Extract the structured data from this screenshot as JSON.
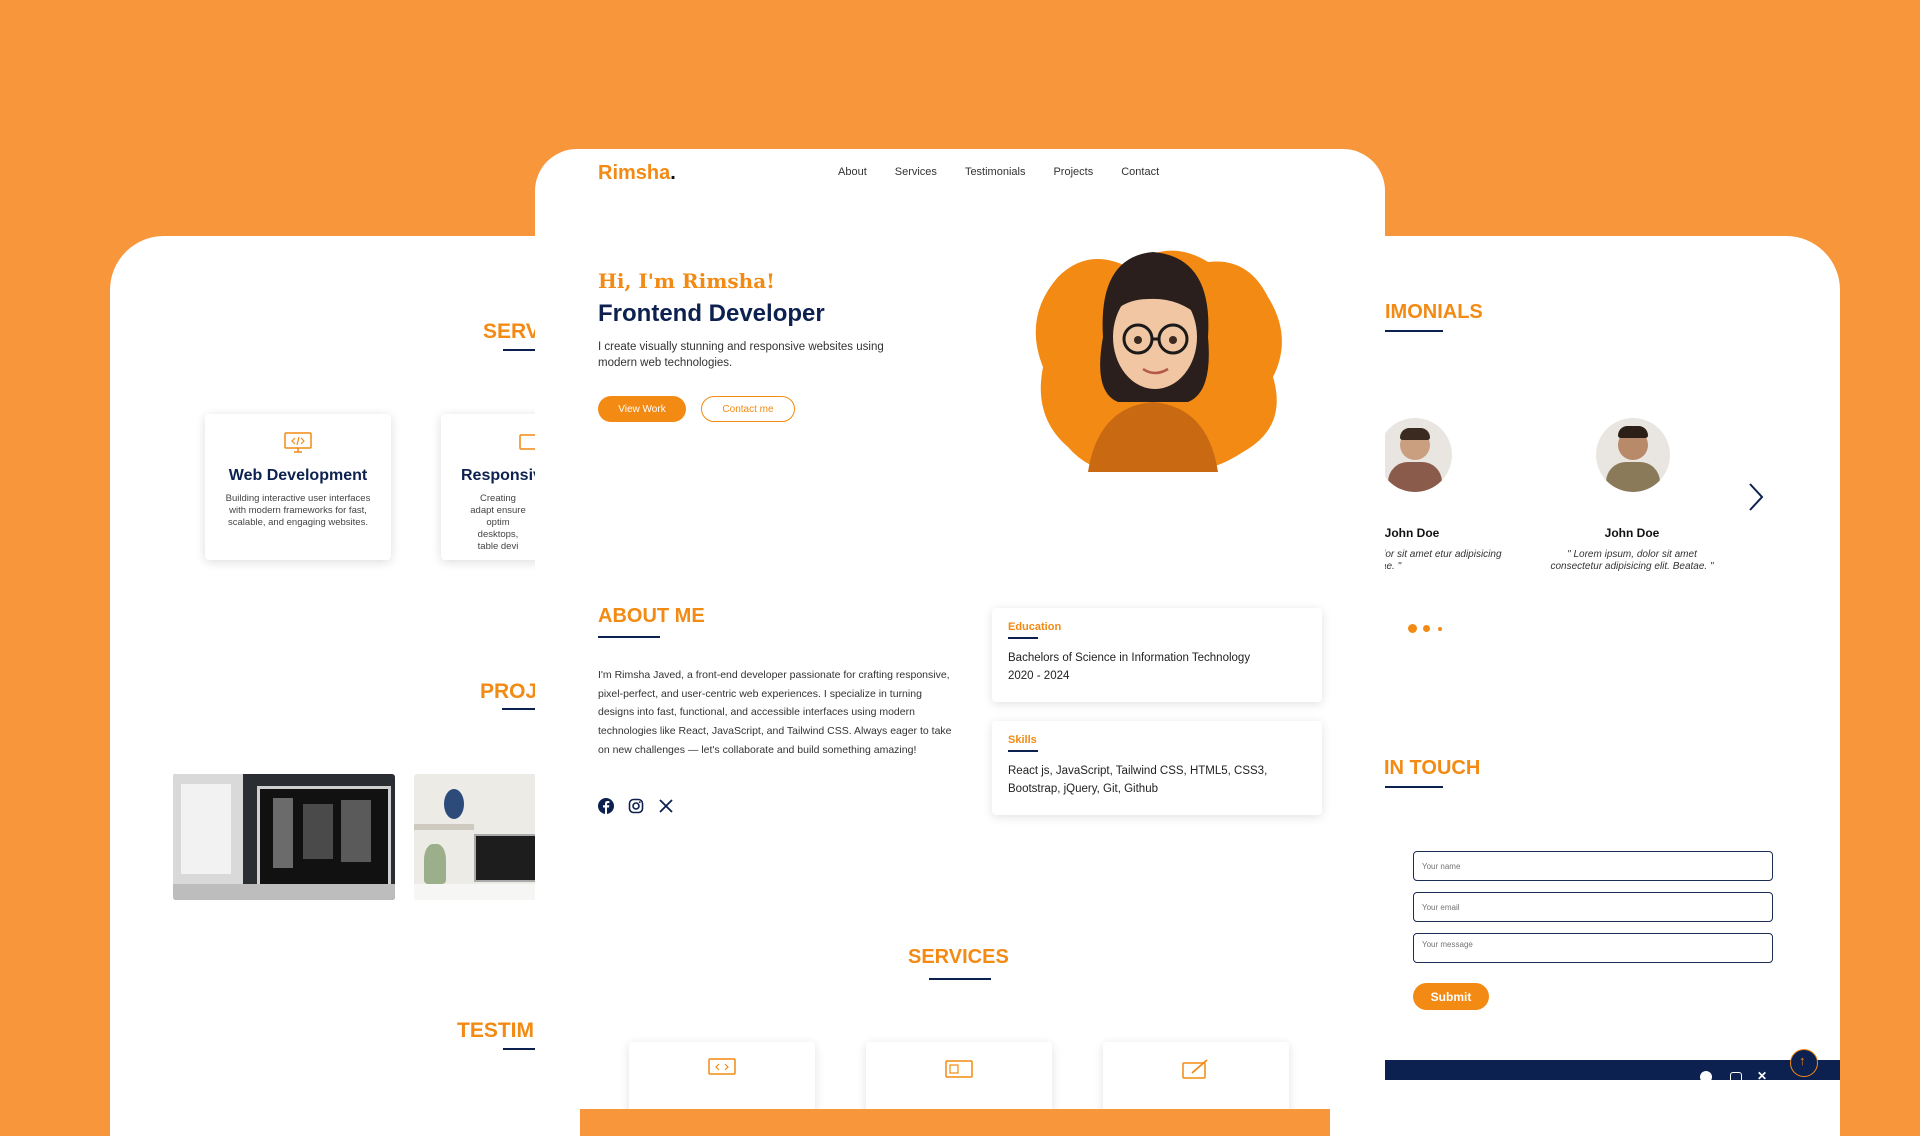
{
  "brand": {
    "name": "Rimsha",
    "dot": "."
  },
  "nav": [
    "About",
    "Services",
    "Testimonials",
    "Projects",
    "Contact"
  ],
  "hero": {
    "greeting": "Hi, I'm Rimsha!",
    "role": "Frontend Developer",
    "description": "I create visually stunning and responsive websites using modern web technologies.",
    "primary_button": "View Work",
    "secondary_button": "Contact me"
  },
  "about": {
    "heading": "ABOUT ME",
    "text": "I'm Rimsha Javed, a front-end developer passionate for crafting responsive, pixel-perfect, and user-centric web experiences. I specialize in turning designs into fast, functional, and accessible interfaces using modern technologies like React, JavaScript, and Tailwind CSS. Always eager to take on new challenges — let's collaborate and build something amazing!",
    "education_label": "Education",
    "education_text": "Bachelors of Science in Information Technology 2020 - 2024",
    "skills_label": "Skills",
    "skills_text": "React js, JavaScript, Tailwind CSS, HTML5, CSS3, Bootstrap, jQuery, Git, Github"
  },
  "services_heading": "SERVICES",
  "left_panel": {
    "services_heading_partial": "SERV",
    "projects_heading_partial": "PROJ",
    "testimonials_heading_partial": "TESTIM",
    "card1_title": "Web Development",
    "card1_desc": "Building interactive user interfaces with modern frameworks for fast, scalable, and engaging websites.",
    "card2_title": "Responsiv",
    "card2_desc": "Creating adapt ensure optim desktops, table devi"
  },
  "right_panel": {
    "testimonials_heading_partial": "IMONIALS",
    "contact_heading_partial": "IN TOUCH",
    "testimonials": [
      {
        "name": "John Doe",
        "quote": "osum, dolor sit amet etur adipisicing elit. Beatae. \""
      },
      {
        "name": "John Doe",
        "quote": "\" Lorem ipsum, dolor sit amet consectetur adipisicing elit. Beatae. \""
      }
    ],
    "form": {
      "name_placeholder": "Your name",
      "email_placeholder": "Your email",
      "message_placeholder": "Your message",
      "submit": "Submit"
    }
  },
  "colors": {
    "accent": "#F28A13",
    "navy": "#0d2150",
    "background": "#F7963B"
  }
}
